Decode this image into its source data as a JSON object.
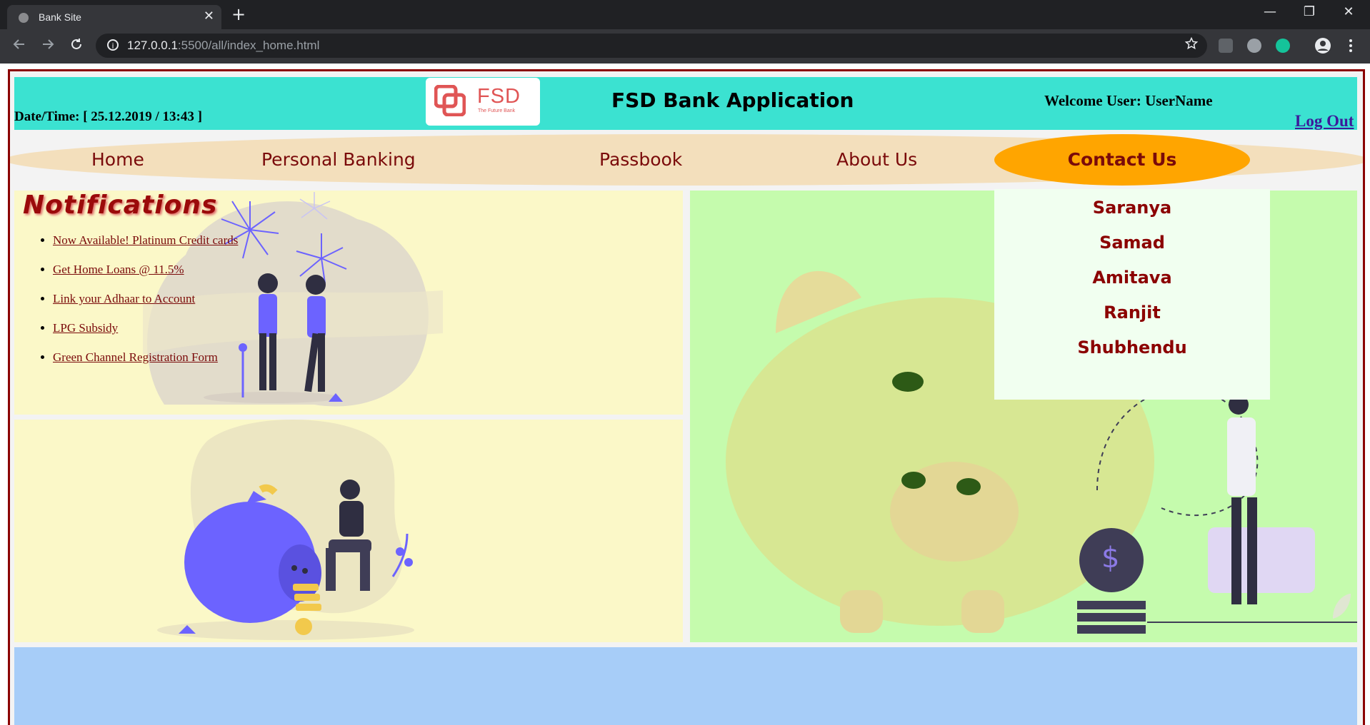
{
  "browser": {
    "tab_title": "Bank Site",
    "tab_close": "✕",
    "new_tab": "+",
    "url_host": "127.0.0.1",
    "url_rest": ":5500/all/index_home.html",
    "minimize": "—",
    "restore": "❐",
    "close": "✕"
  },
  "header": {
    "datetime": "Date/Time: [ 25.12.2019 / 13:43 ]",
    "logo_text": "FSD",
    "logo_sub": "The Future Bank",
    "title": "FSD Bank Application",
    "welcome": "Welcome User: UserName",
    "logout": "Log Out"
  },
  "nav": {
    "home": "Home",
    "personal_banking": "Personal Banking",
    "passbook": "Passbook",
    "about_us": "About Us",
    "contact_us": "Contact Us"
  },
  "contacts": [
    "Saranya",
    "Samad",
    "Amitava",
    "Ranjit",
    "Shubhendu"
  ],
  "notifications": {
    "title": "Notifications",
    "items": [
      "Now Available! Platinum Credit cards",
      "Get Home Loans @ 11.5%",
      "Link your Adhaar to Account",
      "LPG Subsidy",
      "Green Channel Registration Form"
    ]
  },
  "colors": {
    "header_bg": "#3be2d1",
    "nav_bg": "#f3dfbc",
    "nav_active": "#ffa500",
    "accent_text": "#7a0a0a",
    "panel_yellow": "#fbf8c8",
    "panel_green": "#c5fbad",
    "panel_blue": "#a7cdf8",
    "border": "#8b0000"
  },
  "icons": {
    "back": "arrow-left-icon",
    "forward": "arrow-right-icon",
    "reload": "reload-icon",
    "star": "star-icon",
    "account": "account-icon",
    "menu": "more-vert-icon",
    "coin": "dollar-icon"
  }
}
